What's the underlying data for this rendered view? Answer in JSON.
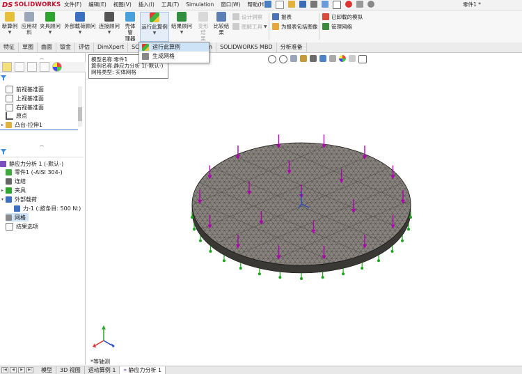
{
  "app": {
    "brand_ds": "DS",
    "brand_name": "SOLIDWORKS",
    "document_title": "零件1 *"
  },
  "menu": [
    "文件(F)",
    "编辑(E)",
    "视图(V)",
    "插入(I)",
    "工具(T)",
    "Simulation",
    "窗口(W)",
    "帮助(H)"
  ],
  "ribbon": {
    "new_study": "新算例",
    "apply_material": "应用材\n料",
    "fixtures": "夹具顾问",
    "external_loads": "外部载荷顾问",
    "connections": "连接顾问",
    "shell_manager": "壳体管\n理器",
    "run_study": "运行此算例",
    "results_advisor": "结果顾问",
    "deformed_result": "变形结\n果",
    "compare_results": "比较结\n果",
    "design_insight": "设计洞察",
    "plot_tools": "图解工具",
    "report": "报表",
    "include_image": "为报表包括图像",
    "unloaded_sims": "已卸载的模拟",
    "manage_network": "管理网络"
  },
  "tabs": [
    {
      "label": "特征",
      "active": false
    },
    {
      "label": "草图",
      "active": false
    },
    {
      "label": "曲面",
      "active": false
    },
    {
      "label": "钣金",
      "active": false
    },
    {
      "label": "评估",
      "active": false
    },
    {
      "label": "DimXpert",
      "active": false
    },
    {
      "label": "SO",
      "active": false
    },
    {
      "label": "on",
      "active": false
    },
    {
      "label": "SOLIDWORKS MBD",
      "active": false
    },
    {
      "label": "分析准备",
      "active": false
    }
  ],
  "dropdown": {
    "items": [
      "运行此算例",
      "生成网格"
    ]
  },
  "tooltip": {
    "line1": "模型名称:零件1",
    "line2": "算例名称:静应力分析 1(-默认-)",
    "line3": "网格类型: 实体网格"
  },
  "feature_tree": [
    "前视基准面",
    "上视基准面",
    "右视基准面",
    "原点",
    "凸台-拉伸1"
  ],
  "study_tree": {
    "root": "静应力分析 1 (-默认-)",
    "items": [
      "零件1 (-AISI 304-)",
      "连结",
      "夹具",
      "外部载荷",
      "力-1 (:按条目: 500 N:)",
      "网格",
      "结果选项"
    ]
  },
  "view": {
    "orientation_label": "*等轴测"
  },
  "bottom_tabs": [
    {
      "label": "模型",
      "active": false
    },
    {
      "label": "3D 视图",
      "active": false
    },
    {
      "label": "运动算例 1",
      "active": false
    },
    {
      "label": "静应力分析 1",
      "active": true
    }
  ],
  "colors": {
    "accent": "#c8102e",
    "load_arrow": "#b000b0",
    "fixture": "#1aa51a",
    "mesh_fill": "#8a857f",
    "highlight": "#cfe3f7"
  }
}
